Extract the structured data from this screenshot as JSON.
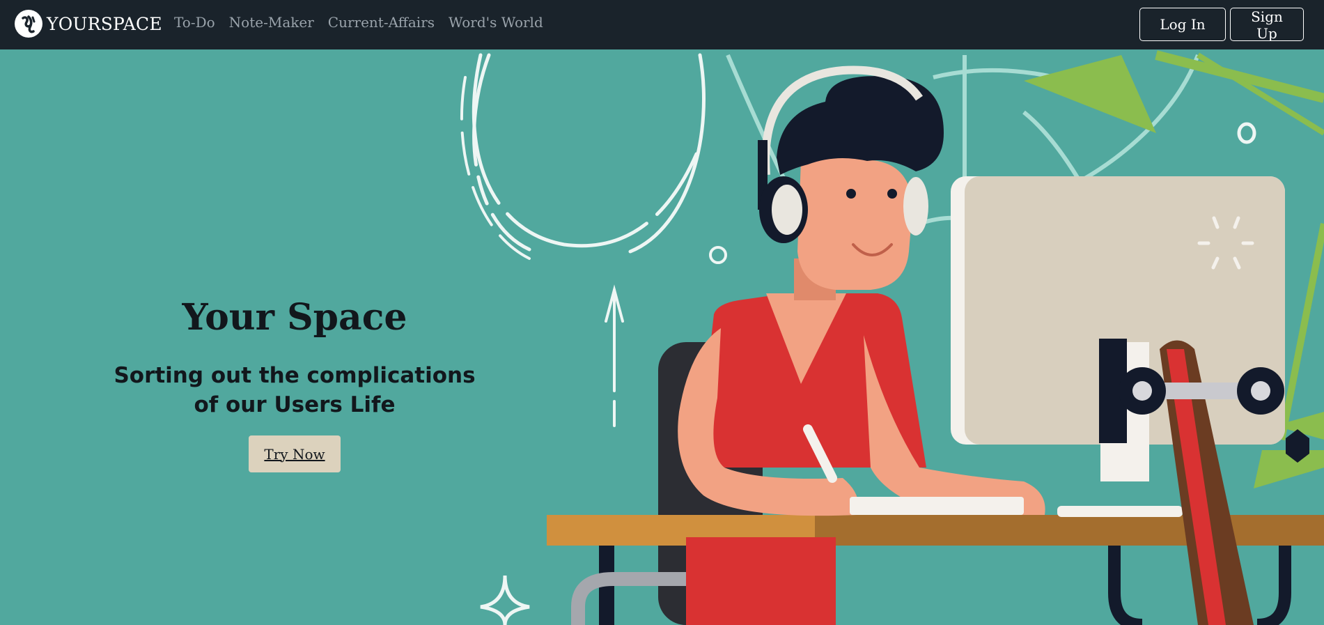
{
  "brand": {
    "name": "YOURSPACE",
    "logo_icon": "ys-monogram-icon"
  },
  "nav": {
    "links": [
      {
        "label": "To-Do"
      },
      {
        "label": "Note-Maker"
      },
      {
        "label": "Current-Affairs"
      },
      {
        "label": "Word's World"
      }
    ]
  },
  "auth": {
    "login_label": "Log In",
    "signup_label": "Sign Up"
  },
  "hero": {
    "title": "Your Space",
    "subtitle_line1": "Sorting out the complications",
    "subtitle_line2": "of our Users Life",
    "cta_label": "Try Now",
    "illustration_icon": "person-at-desk-with-headphones-illustration"
  },
  "colors": {
    "navbar_bg": "#1a232b",
    "hero_bg": "#51a89e",
    "cta_bg": "#dcd2bd",
    "shirt_red": "#d93232",
    "desk_wood": "#c98a3c"
  }
}
